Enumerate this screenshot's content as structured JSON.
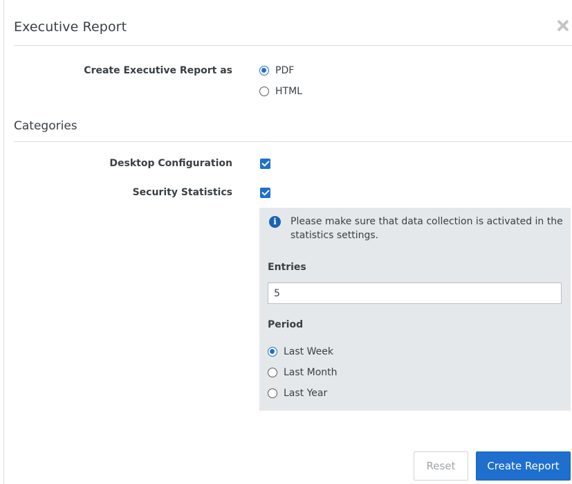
{
  "dialog": {
    "title": "Executive Report"
  },
  "format": {
    "label": "Create Executive Report as",
    "options": [
      {
        "label": "PDF",
        "selected": true
      },
      {
        "label": "HTML",
        "selected": false
      }
    ]
  },
  "categories": {
    "title": "Categories",
    "items": [
      {
        "label": "Desktop Configuration",
        "checked": true
      },
      {
        "label": "Security Statistics",
        "checked": true
      }
    ]
  },
  "statistics": {
    "info": "Please make sure that data collection is activated in the statistics settings.",
    "entries_label": "Entries",
    "entries_value": "5",
    "period_label": "Period",
    "period_options": [
      {
        "label": "Last Week",
        "selected": true
      },
      {
        "label": "Last Month",
        "selected": false
      },
      {
        "label": "Last Year",
        "selected": false
      }
    ]
  },
  "buttons": {
    "reset": "Reset",
    "create": "Create Report"
  },
  "colors": {
    "accent": "#1f6fce",
    "panel_bg": "#e4e8eb"
  },
  "icons": {
    "close": "close-icon",
    "info": "info-icon"
  }
}
